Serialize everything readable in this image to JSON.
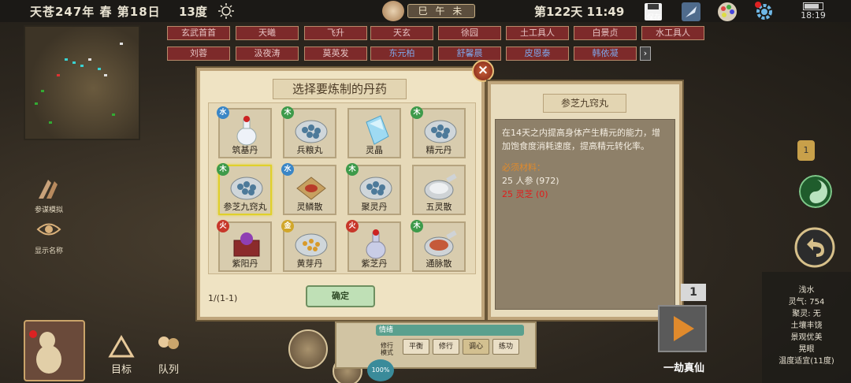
{
  "topbar": {
    "date": "天苍247年 春 第18日",
    "temperature": "13度",
    "time_scroll": "巳 午 未",
    "day_time": "第122天 11:49",
    "save_label": "保存",
    "clock": "18:19"
  },
  "name_tags": {
    "row1": [
      "玄武首首",
      "天曦",
      "飞升",
      "天玄",
      "徐园",
      "土工具人",
      "白景贞",
      "水工具人"
    ],
    "row2": [
      "刘蓉",
      "汲夜涛",
      "莫英发",
      "东元柏",
      "舒馨晨",
      "皮恩泰",
      "韩依凝"
    ],
    "more": "›"
  },
  "side_buttons": {
    "mock_battle": "参谋模拟",
    "show_names": "显示名称"
  },
  "alchemy": {
    "title": "选择要炼制的丹药",
    "close": "×",
    "items": [
      {
        "name": "筑基丹",
        "element": "水",
        "art": "bottle"
      },
      {
        "name": "兵粮丸",
        "element": "木",
        "art": "bowl"
      },
      {
        "name": "灵晶",
        "element": "",
        "art": "crystal"
      },
      {
        "name": "精元丹",
        "element": "木",
        "art": "bowl"
      },
      {
        "name": "参芝九窍丸",
        "element": "木",
        "art": "bowl",
        "selected": true
      },
      {
        "name": "灵鳞散",
        "element": "水",
        "art": "scroll"
      },
      {
        "name": "聚灵丹",
        "element": "木",
        "art": "bowl"
      },
      {
        "name": "五灵散",
        "element": "",
        "art": "powder"
      },
      {
        "name": "紫阳丹",
        "element": "火",
        "art": "box"
      },
      {
        "name": "黄芽丹",
        "element": "金",
        "art": "goldbowl"
      },
      {
        "name": "紫芝丹",
        "element": "火",
        "art": "bottle2"
      },
      {
        "name": "通脉散",
        "element": "木",
        "art": "powder2"
      }
    ],
    "page": "1/(1-1)",
    "confirm": "确定"
  },
  "detail": {
    "title": "参芝九窍丸",
    "description": "在14天之内提高身体产生精元的能力，增加饱食度消耗速度，提高精元转化率。",
    "requirements_title": "必须材料：",
    "req1": "25 人参 (972)",
    "req2": "25 灵芝 (0)"
  },
  "bottom": {
    "goal": "目标",
    "team": "队列",
    "mood": "情绪",
    "modes": [
      "平衡",
      "修行",
      "调心",
      "练功"
    ],
    "sub_label": "修行模式",
    "percent": "100%",
    "action": "一劫真仙",
    "badge": "1"
  },
  "stats": {
    "lines": [
      "浅水",
      "灵气: 754",
      "聚灵: 无",
      "土壤丰饶",
      "景观优美",
      "晃眼",
      "温度适宜(11度)"
    ]
  },
  "colors": {
    "wood": "#3d9a4a",
    "water": "#3a86c6",
    "fire": "#c7372a",
    "metal": "#d1a72a"
  }
}
